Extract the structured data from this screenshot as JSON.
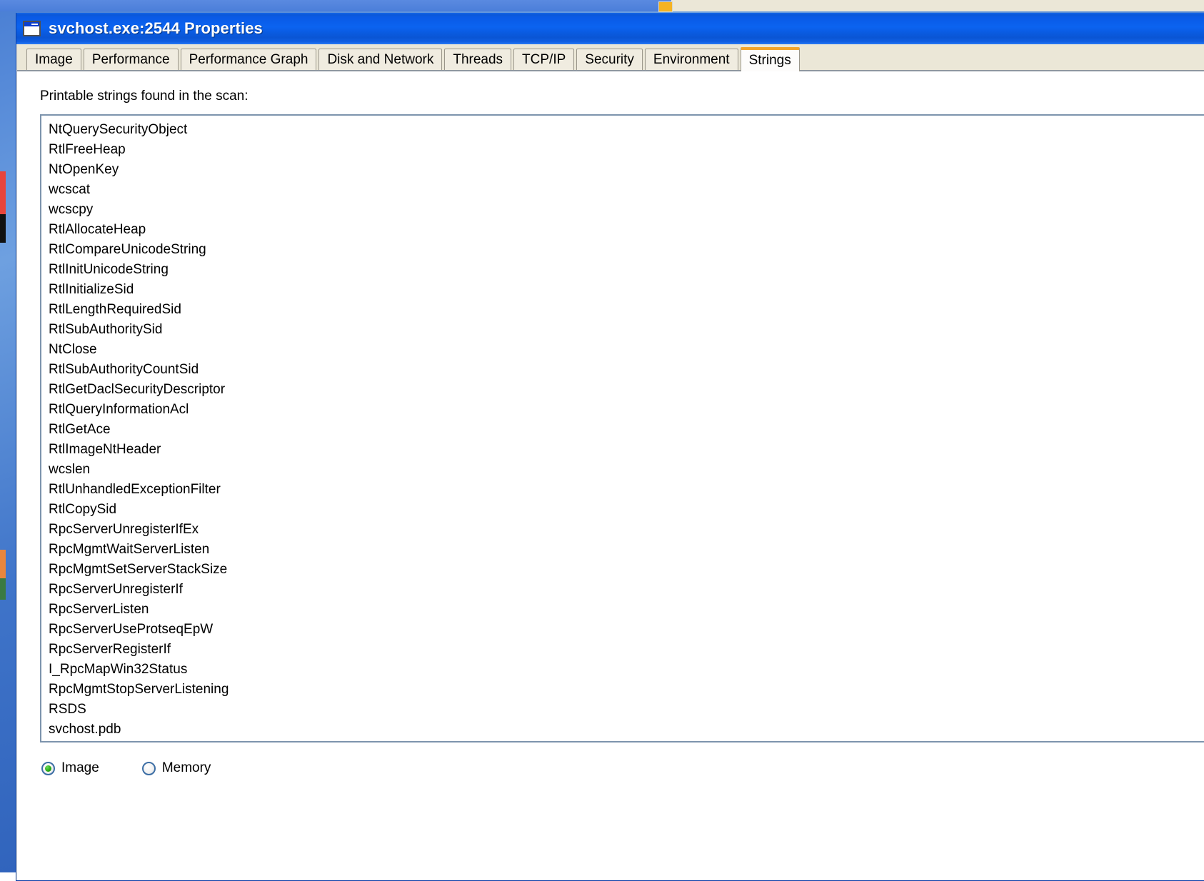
{
  "window": {
    "title": "svchost.exe:2544 Properties",
    "icon": "window-icon"
  },
  "tabs": [
    {
      "label": "Image",
      "active": false
    },
    {
      "label": "Performance",
      "active": false
    },
    {
      "label": "Performance Graph",
      "active": false
    },
    {
      "label": "Disk and Network",
      "active": false
    },
    {
      "label": "Threads",
      "active": false
    },
    {
      "label": "TCP/IP",
      "active": false
    },
    {
      "label": "Security",
      "active": false
    },
    {
      "label": "Environment",
      "active": false
    },
    {
      "label": "Strings",
      "active": true
    }
  ],
  "strings_tab": {
    "scan_label": "Printable strings found in the scan:",
    "entries": [
      "NtQuerySecurityObject",
      "RtlFreeHeap",
      "NtOpenKey",
      "wcscat",
      "wcscpy",
      "RtlAllocateHeap",
      "RtlCompareUnicodeString",
      "RtlInitUnicodeString",
      "RtlInitializeSid",
      "RtlLengthRequiredSid",
      "RtlSubAuthoritySid",
      "NtClose",
      "RtlSubAuthorityCountSid",
      "RtlGetDaclSecurityDescriptor",
      "RtlQueryInformationAcl",
      "RtlGetAce",
      "RtlImageNtHeader",
      "wcslen",
      "RtlUnhandledExceptionFilter",
      "RtlCopySid",
      "RpcServerUnregisterIfEx",
      "RpcMgmtWaitServerListen",
      "RpcMgmtSetServerStackSize",
      "RpcServerUnregisterIf",
      "RpcServerListen",
      "RpcServerUseProtseqEpW",
      "RpcServerRegisterIf",
      "I_RpcMapWin32Status",
      "RpcMgmtStopServerListening",
      "RSDS",
      "svchost.pdb"
    ],
    "source_options": [
      {
        "label": "Image",
        "selected": true
      },
      {
        "label": "Memory",
        "selected": false
      }
    ]
  },
  "colors": {
    "titlebar_blue": "#0b63f0",
    "tabstrip_beige": "#ebe7d7",
    "active_tab_accent": "#f3a42a",
    "listbox_border": "#7d94ad",
    "radio_selected_green": "#25a814"
  }
}
